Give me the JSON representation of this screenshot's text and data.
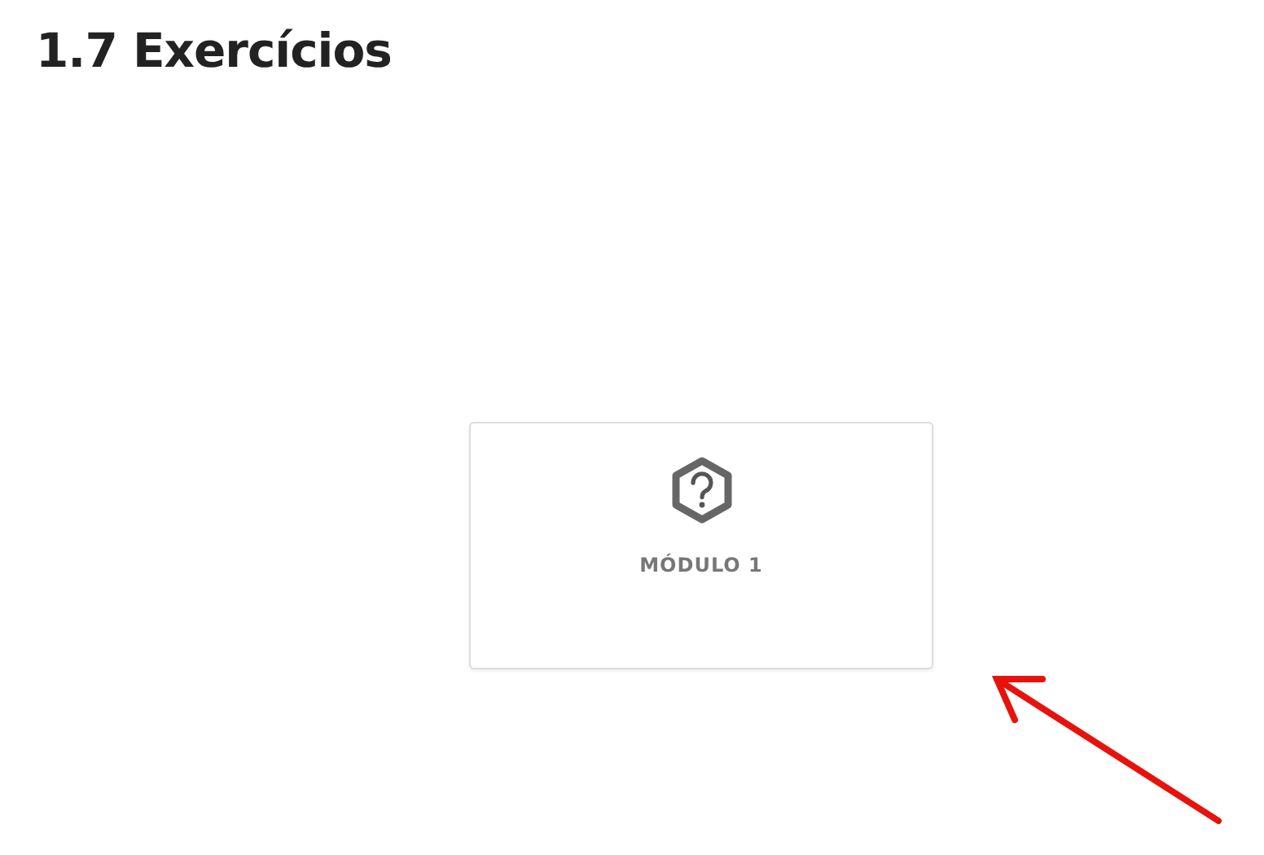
{
  "heading": "1.7 Exercícios",
  "modules": [
    {
      "label": "MÓDULO 1",
      "kind": "quiz"
    }
  ]
}
